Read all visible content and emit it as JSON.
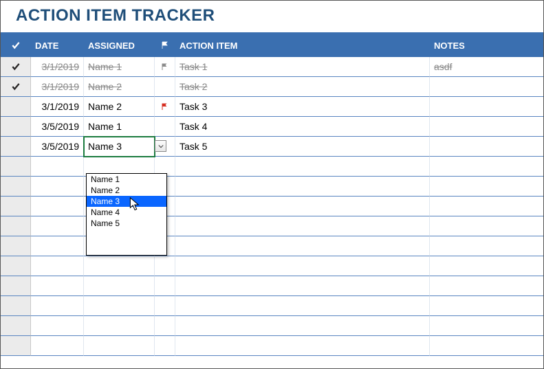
{
  "title": "ACTION ITEM TRACKER",
  "columns": {
    "date": "DATE",
    "assigned": "ASSIGNED",
    "action_item": "ACTION ITEM",
    "notes": "NOTES"
  },
  "rows": [
    {
      "done": true,
      "flag": "gray",
      "date": "3/1/2019",
      "assigned": "Name 1",
      "item": "Task 1",
      "notes": "asdf"
    },
    {
      "done": true,
      "flag": "",
      "date": "3/1/2019",
      "assigned": "Name 2",
      "item": "Task 2",
      "notes": ""
    },
    {
      "done": false,
      "flag": "red",
      "date": "3/1/2019",
      "assigned": "Name 2",
      "item": "Task 3",
      "notes": ""
    },
    {
      "done": false,
      "flag": "",
      "date": "3/5/2019",
      "assigned": "Name 1",
      "item": "Task 4",
      "notes": ""
    },
    {
      "done": false,
      "flag": "",
      "date": "3/5/2019",
      "assigned": "Name 3",
      "item": "Task 5",
      "notes": ""
    }
  ],
  "dropdown": {
    "options": [
      "Name 1",
      "Name 2",
      "Name 3",
      "Name 4",
      "Name 5"
    ],
    "selected_index": 2
  },
  "empty_rows": 10,
  "chart_data": {
    "type": "table",
    "title": "ACTION ITEM TRACKER",
    "columns": [
      "Done",
      "Date",
      "Assigned",
      "Flag",
      "Action Item",
      "Notes"
    ],
    "rows": [
      [
        true,
        "3/1/2019",
        "Name 1",
        "flagged-gray",
        "Task 1",
        "asdf"
      ],
      [
        true,
        "3/1/2019",
        "Name 2",
        "",
        "Task 2",
        ""
      ],
      [
        false,
        "3/1/2019",
        "Name 2",
        "flagged-red",
        "Task 3",
        ""
      ],
      [
        false,
        "3/5/2019",
        "Name 1",
        "",
        "Task 4",
        ""
      ],
      [
        false,
        "3/5/2019",
        "Name 3",
        "",
        "Task 5",
        ""
      ]
    ]
  }
}
